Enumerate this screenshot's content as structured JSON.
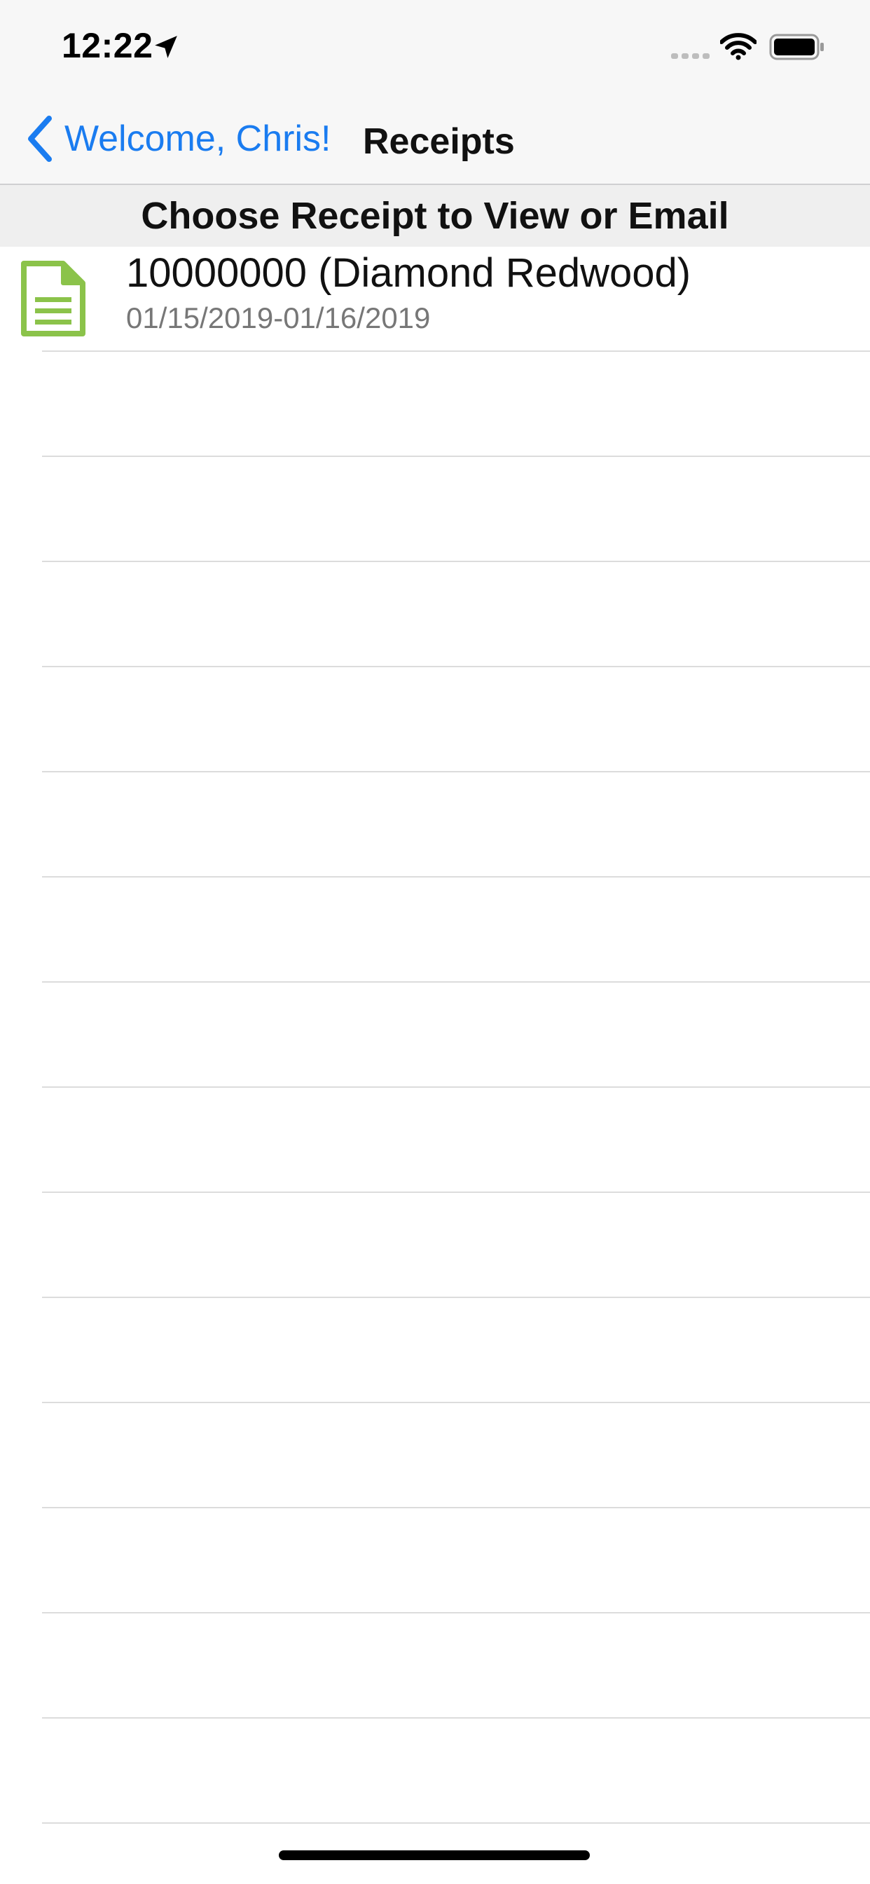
{
  "status_bar": {
    "time": "12:22",
    "icons": [
      "location-arrow-icon",
      "cellular-dots-icon",
      "wifi-icon",
      "battery-icon"
    ]
  },
  "nav": {
    "back_label": "Welcome, Chris!",
    "title": "Receipts"
  },
  "section": {
    "header": "Choose Receipt to View or Email"
  },
  "receipts": [
    {
      "title": "10000000 (Diamond Redwood)",
      "dates": "01/15/2019-01/16/2019",
      "icon": "document-icon"
    }
  ],
  "colors": {
    "accent": "#1a7cf0",
    "doc_icon": "#8bc34a",
    "header_bg": "#efefef"
  }
}
